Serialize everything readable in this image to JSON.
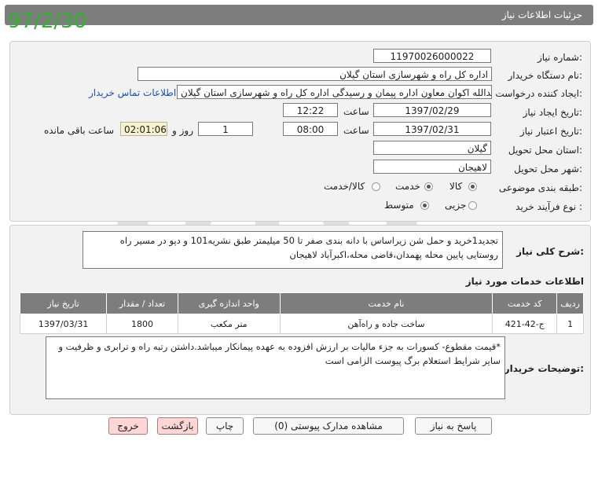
{
  "overlay_date": "97/2/30",
  "header": {
    "title": "جزئیات اطلاعات نیاز"
  },
  "form": {
    "need_number_label": "شماره نیاز:",
    "need_number": "1197002600002­2",
    "buyer_org_label": "نام دستگاه خریدار:",
    "buyer_org": "اداره کل راه و شهرسازی استان گیلان",
    "requester_label": "ایجاد کننده درخواست:",
    "requester": "اسدالله اکوان معاون اداره پیمان و رسیدگی اداره کل راه و شهرسازی استان گیلان",
    "contact_link": "اطلاعات تماس خریدار",
    "created_label": "تاریخ ایجاد نیاز:",
    "created_date": "1397/02/29",
    "time_label": "ساعت",
    "created_time": "12:22",
    "valid_label": "تاریخ اعتبار نیاز:",
    "valid_date": "1397/02/31",
    "valid_time": "08:00",
    "days": "1",
    "days_label": "روز و",
    "remaining": "02:01:06",
    "remaining_label": "ساعت باقی مانده",
    "province_label": "استان محل تحویل:",
    "province": "گیلان",
    "city_label": "شهر محل تحویل:",
    "city": "لاهیجان",
    "category_label": "طبقه بندی موضوعی:",
    "category_options": [
      "کالا",
      "خدمت",
      "کالا/خدمت"
    ],
    "category_selected": "خدمت",
    "process_label": "نوع فرآیند خرید :",
    "process_options": [
      "جزیی",
      "متوسط"
    ],
    "process_selected": "متوسط"
  },
  "description": {
    "label": "شرح کلی نیاز:",
    "line1": "تجدید1خرید و حمل شن  زیراساس با دانه بندی صفر تا 50 میلیمتر طبق  نشریه101 و دپو در مسیر راه",
    "line2": "روستایی پایین محله پهمدان،قاضی محله،اکبرآباد لاهیجان"
  },
  "services": {
    "heading": "اطلاعات خدمات مورد نیاز",
    "columns": [
      "ردیف",
      "کد خدمت",
      "نام خدمت",
      "واحد اندازه گیری",
      "تعداد / مقدار",
      "تاریخ نیاز"
    ],
    "rows": [
      [
        "1",
        "ج-42-421",
        "ساخت جاده و راه‌آهن",
        "متر مکعب",
        "1800",
        "1397/03/31"
      ]
    ]
  },
  "buyer_notes": {
    "label": "توضیحات خریدار:",
    "line1": "*قیمت مقطوع- کسورات به جزء مالیات بر ارزش افزوده به عهده پیمانکار میباشد.داشتن رتبه راه و ترابری و ظرفیت و",
    "line2": "سایر شرایط استعلام برگ پیوست الزامی است"
  },
  "buttons": {
    "reply": "پاسخ به نیاز",
    "attachments": "مشاهده مدارک پیوستی (0)",
    "print": "چاپ",
    "back": "بازگشت",
    "exit": "خروج"
  }
}
